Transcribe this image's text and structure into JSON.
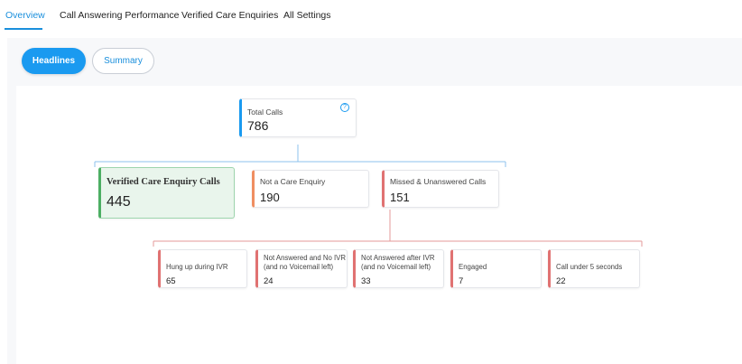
{
  "tabs": [
    {
      "label": "Overview",
      "active": true
    },
    {
      "label": "Call Answering Performance",
      "active": false
    },
    {
      "label": "Verified Care Enquiries",
      "active": false
    },
    {
      "label": "All Settings",
      "active": false
    }
  ],
  "buttons": {
    "headlines": "Headlines",
    "summary": "Summary"
  },
  "total": {
    "label": "Total Calls",
    "value": "786",
    "help_icon": "?"
  },
  "level1": {
    "verified": {
      "label": "Verified Care Enquiry Calls",
      "value": "445"
    },
    "not_care": {
      "label": "Not a Care Enquiry",
      "value": "190"
    },
    "missed": {
      "label": "Missed & Unanswered Calls",
      "value": "151"
    }
  },
  "level2": [
    {
      "label": "Hung up during IVR",
      "value": "65"
    },
    {
      "label": "Not Answered and No IVR\n(and no Voicemail left)",
      "value": "24"
    },
    {
      "label": "Not Answered after IVR\n(and no Voicemail left)",
      "value": "33"
    },
    {
      "label": "Engaged",
      "value": "7"
    },
    {
      "label": "Call under 5 seconds",
      "value": "22"
    }
  ],
  "colors": {
    "accent": "#1a9af0",
    "verified": "#4caf63",
    "not_care": "#ef8e61",
    "missed": "#e07272"
  }
}
